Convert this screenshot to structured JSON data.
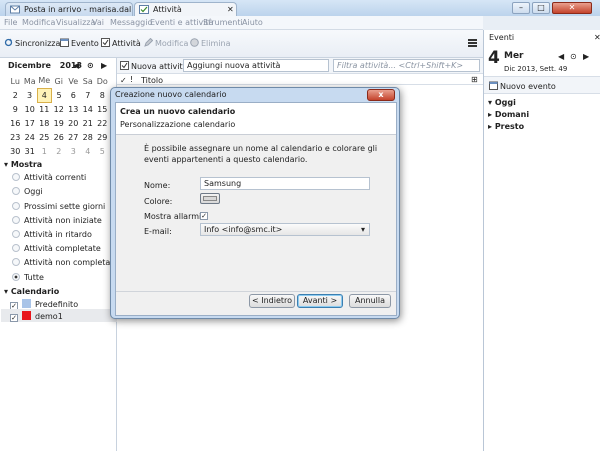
{
  "tabs": [
    {
      "label": "Posta in arrivo - marisa.dalla..."
    },
    {
      "label": "Attività"
    }
  ],
  "window_controls": {
    "minimize": "–",
    "maximize": "□",
    "close": "✕"
  },
  "menu": [
    "File",
    "Modifica",
    "Visualizza",
    "Vai",
    "Messaggio",
    "Eventi e attività",
    "Strumenti",
    "Aiuto"
  ],
  "toolbar": {
    "sync": "Sincronizza",
    "event": "Evento",
    "task": "Attività",
    "edit": "Modifica",
    "delete": "Elimina"
  },
  "minical": {
    "month": "Dicembre",
    "year": "2013",
    "day_names": [
      "Lu",
      "Ma",
      "Me",
      "Gi",
      "Ve",
      "Sa",
      "Do"
    ],
    "weeks": [
      [
        "2",
        "3",
        "4",
        "5",
        "6",
        "7",
        "8"
      ],
      [
        "9",
        "10",
        "11",
        "12",
        "13",
        "14",
        "15"
      ],
      [
        "16",
        "17",
        "18",
        "19",
        "20",
        "21",
        "22"
      ],
      [
        "23",
        "24",
        "25",
        "26",
        "27",
        "28",
        "29"
      ],
      [
        "30",
        "31",
        "1",
        "2",
        "3",
        "4",
        "5"
      ]
    ],
    "today": "4"
  },
  "show": {
    "title": "Mostra",
    "filters": [
      "Attività correnti",
      "Oggi",
      "Prossimi sette giorni",
      "Attività non iniziate",
      "Attività in ritardo",
      "Attività completate",
      "Attività non completate",
      "Tutte"
    ],
    "selected": "Tutte"
  },
  "calendars": {
    "title": "Calendario",
    "items": [
      {
        "name": "Predefinito",
        "color": "#a9c4e8"
      },
      {
        "name": "demo1",
        "color": "#e8151b"
      }
    ]
  },
  "tasks": {
    "new_button": "Nuova attività",
    "new_placeholder": "Aggiungi nuova attività",
    "filter_placeholder": "Filtra attività... <Ctrl+Shift+K>",
    "col_title": "Titolo"
  },
  "events": {
    "title": "Eventi",
    "day_number": "4",
    "weekday": "Mer",
    "month_week": "Dic 2013, Sett. 49",
    "new_event": "Nuovo evento",
    "groups": [
      "Oggi",
      "Domani",
      "Presto"
    ]
  },
  "dialog": {
    "title": "Creazione nuovo calendario",
    "close": "x",
    "heading": "Crea un nuovo calendario",
    "subheading": "Personalizzazione calendario",
    "description": "È possibile assegnare un nome al calendario e colorare gli eventi appartenenti a questo calendario.",
    "name_label": "Nome:",
    "name_value": "Samsung",
    "color_label": "Colore:",
    "alarms_label": "Mostra allarmi:",
    "alarms_checked": "✓",
    "email_label": "E-mail:",
    "email_value": "Info <info@smc.it>",
    "back": "< Indietro",
    "next": "Avanti >",
    "cancel": "Annulla"
  }
}
